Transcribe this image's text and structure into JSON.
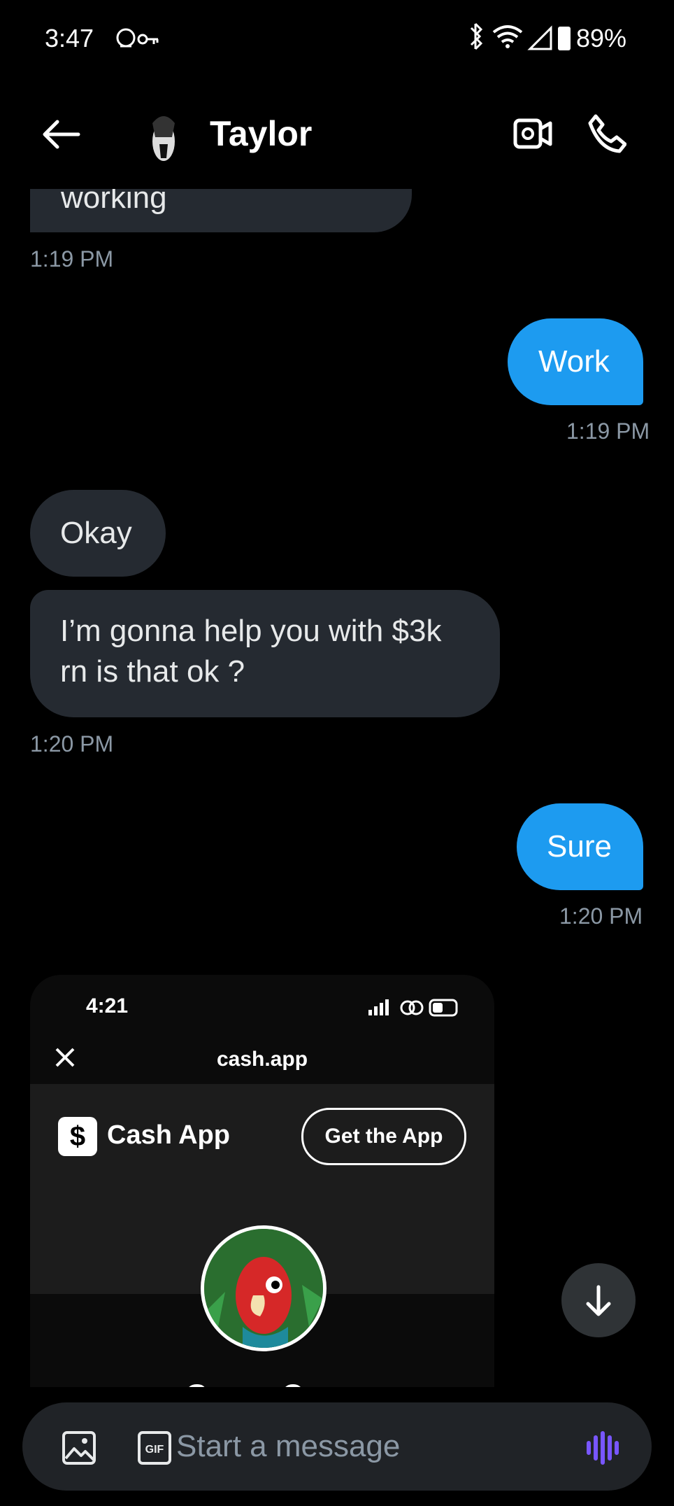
{
  "status_bar": {
    "time": "3:47",
    "battery_pct": "89%"
  },
  "header": {
    "contact_name": "Taylor",
    "icons": [
      "back-arrow-icon",
      "video-call-icon",
      "phone-call-icon"
    ]
  },
  "messages": [
    {
      "dir": "in",
      "text": "working",
      "timestamp": "1:19 PM"
    },
    {
      "dir": "out",
      "text": "Work",
      "timestamp": "1:19 PM"
    },
    {
      "dir": "in",
      "text": "Okay"
    },
    {
      "dir": "in",
      "text_line1": "I’m gonna help you with $3k",
      "text_line2": "rn is that ok ?",
      "timestamp": "1:20 PM"
    },
    {
      "dir": "out",
      "text": "Sure",
      "timestamp": "1:20 PM"
    }
  ],
  "attachment": {
    "phone_time": "4:21",
    "url": "cash.app",
    "brand_glyph": "$",
    "brand_name": "Cash App",
    "cta": "Get the App",
    "profile_name_partial": "Ganza Og"
  },
  "composer": {
    "placeholder": "Start a message"
  },
  "colors": {
    "accent": "#1d9bf0",
    "incoming_bubble": "#252a31",
    "voice_icon": "#7856ff"
  }
}
